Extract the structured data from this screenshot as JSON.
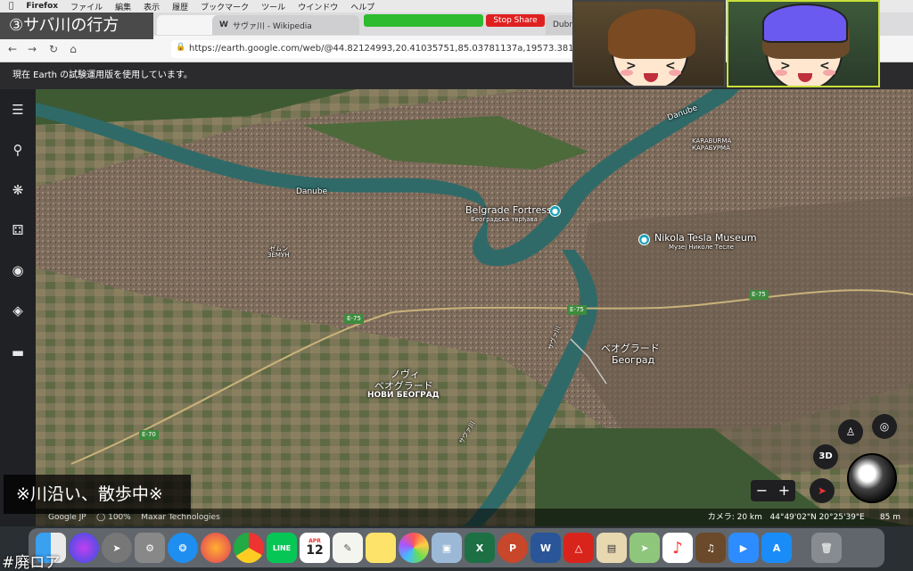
{
  "menubar": {
    "app": "Firefox",
    "items": [
      "ファイル",
      "編集",
      "表示",
      "履歴",
      "ブックマーク",
      "ツール",
      "ウインドウ",
      "ヘルプ"
    ]
  },
  "overlay": {
    "title": "③サバ川の行方",
    "walk_caption": "※川沿い、散歩中※",
    "hashtag": "#廃ロア"
  },
  "browser": {
    "tabs": [
      {
        "label": "サヴァ川 - Wikipedia",
        "icon": "W"
      },
      {
        "label": "Dubro"
      }
    ],
    "url": "https://earth.google.com/web/@44.82124993,20.41035751,85.03781137a,19573.38104873d,3",
    "stop_share": "Stop Share"
  },
  "notice": "現在 Earth の試験運用版を使用しています。",
  "sidebar": {
    "icons": [
      "menu-icon",
      "search-icon",
      "voyager-icon",
      "dice-icon",
      "placemark-icon",
      "layers-icon",
      "ruler-icon"
    ]
  },
  "map": {
    "labels": {
      "danube_top": "Danube",
      "danube_left": "Danube",
      "karaburma_ja": "KARABURMA",
      "karaburma_sr": "КАРАБУРМА",
      "fortress": "Belgrade Fortress",
      "fortress_sr": "Београдска тврђава",
      "tesla": "Nikola Tesla Museum",
      "tesla_sr": "Музеј Николе Тесле",
      "zemun_ja": "ゼムン",
      "zemun_sr": "ЗЕМУН",
      "belgrade_ja": "ベオグラード",
      "belgrade_sr": "Београд",
      "novi_ja1": "ノヴィ",
      "novi_ja2": "ベオグラード",
      "novi_sr": "НОВИ БЕОГРАД",
      "sava1": "サヴァ川",
      "sava2": "サヴァ川"
    },
    "roads": [
      "E-75",
      "E-75",
      "E-75",
      "E-70"
    ]
  },
  "controls": {
    "view3d": "3D",
    "zoom_out": "−",
    "zoom_in": "+"
  },
  "status": {
    "logo": "Google JP",
    "zoom": "100%",
    "attribution": "Maxar Technologies",
    "camera": "カメラ: 20 km",
    "coords": "44°49'02\"N 20°25'39\"E",
    "elevation": "85 m"
  },
  "dock": {
    "items": [
      "Finder",
      "Siri",
      "Launchpad",
      "Settings",
      "Safari",
      "Firefox",
      "Chrome",
      "LINE",
      "Calendar",
      "TextEdit",
      "Notes",
      "Photos",
      "Preview",
      "Excel",
      "PowerPoint",
      "Word",
      "Acrobat",
      "Stocks",
      "Maps",
      "Music",
      "GarageBand",
      "Zoom",
      "App Store",
      "Trash"
    ],
    "calendar_month": "APR",
    "calendar_day": "12"
  }
}
